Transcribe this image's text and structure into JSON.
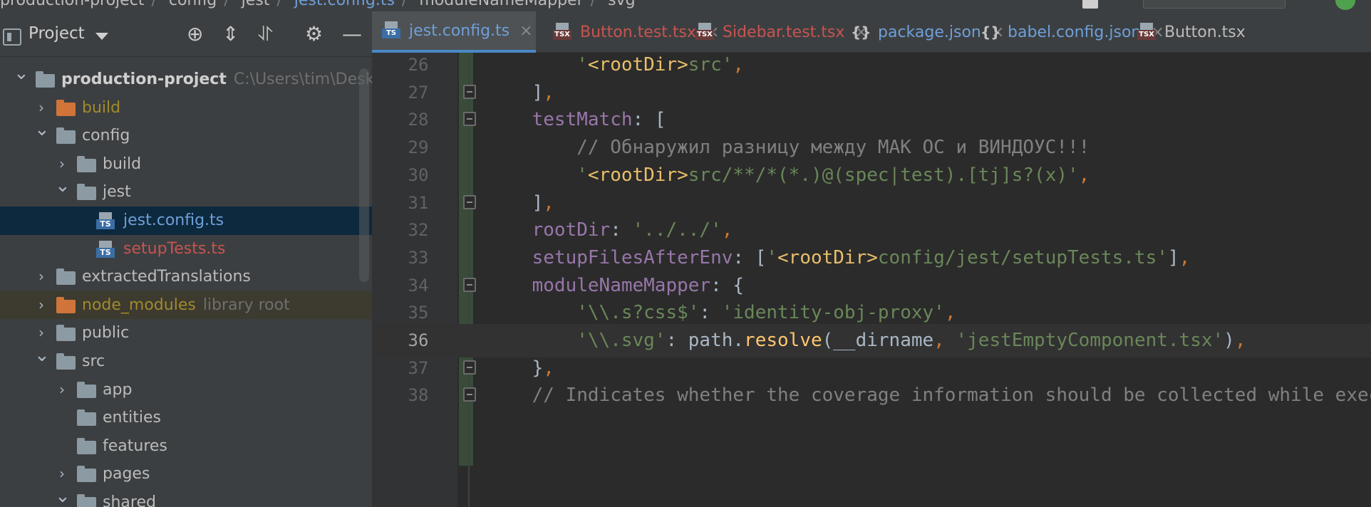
{
  "topbar": {
    "crumbs": [
      "production-project",
      "config",
      "jest",
      "jest.config.ts",
      "moduleNameMapper",
      "svg"
    ]
  },
  "project_panel": {
    "title": "Project",
    "tree": [
      {
        "name": "production-project",
        "hint": "C:\\Users\\tim\\Desktop\\",
        "depth": 0,
        "expanded": true,
        "kind": "folder",
        "style": "bold"
      },
      {
        "name": "build",
        "depth": 1,
        "expanded": false,
        "kind": "folder-orange",
        "style": "olive"
      },
      {
        "name": "config",
        "depth": 1,
        "expanded": true,
        "kind": "folder",
        "style": "normal"
      },
      {
        "name": "build",
        "depth": 2,
        "expanded": false,
        "kind": "folder",
        "style": "normal"
      },
      {
        "name": "jest",
        "depth": 2,
        "expanded": true,
        "kind": "folder",
        "style": "normal"
      },
      {
        "name": "jest.config.ts",
        "depth": 3,
        "kind": "ts",
        "style": "blue",
        "selected": true
      },
      {
        "name": "setupTests.ts",
        "depth": 3,
        "kind": "ts",
        "style": "red"
      },
      {
        "name": "extractedTranslations",
        "depth": 1,
        "expanded": false,
        "kind": "folder",
        "style": "normal"
      },
      {
        "name": "node_modules",
        "hint": "library root",
        "depth": 1,
        "expanded": false,
        "kind": "folder-orange",
        "style": "olive",
        "excluded": true
      },
      {
        "name": "public",
        "depth": 1,
        "expanded": false,
        "kind": "folder",
        "style": "normal"
      },
      {
        "name": "src",
        "depth": 1,
        "expanded": true,
        "kind": "folder",
        "style": "normal"
      },
      {
        "name": "app",
        "depth": 2,
        "expanded": false,
        "kind": "folder",
        "style": "normal"
      },
      {
        "name": "entities",
        "depth": 2,
        "kind": "folder",
        "style": "normal"
      },
      {
        "name": "features",
        "depth": 2,
        "kind": "folder",
        "style": "normal"
      },
      {
        "name": "pages",
        "depth": 2,
        "expanded": false,
        "kind": "folder",
        "style": "normal"
      },
      {
        "name": "shared",
        "depth": 2,
        "expanded": true,
        "kind": "folder",
        "style": "normal"
      }
    ]
  },
  "tabs": [
    {
      "label": "jest.config.ts",
      "icon": "ts",
      "color": "blue",
      "active": true,
      "closable": true
    },
    {
      "label": "Button.test.tsx",
      "icon": "tsx",
      "color": "red",
      "active": false,
      "closable": true
    },
    {
      "label": "Sidebar.test.tsx",
      "icon": "tsx",
      "color": "red",
      "active": false,
      "closable": true
    },
    {
      "label": "package.json",
      "icon": "json",
      "color": "blue",
      "active": false,
      "closable": true
    },
    {
      "label": "babel.config.json",
      "icon": "json",
      "color": "blue",
      "active": false,
      "closable": true
    },
    {
      "label": "Button.tsx",
      "icon": "tsx",
      "color": "normal",
      "active": false,
      "closable": false
    }
  ],
  "code_lines": [
    {
      "num": "26",
      "text": "        '<rootDir>src',"
    },
    {
      "num": "27",
      "text": "    ],"
    },
    {
      "num": "28",
      "text": "    testMatch: ["
    },
    {
      "num": "29",
      "text": "        // Обнаружил разницу между МАК ОС и ВИНДОУС!!!"
    },
    {
      "num": "30",
      "text": "        '<rootDir>src/**/*(*.)@(spec|test).[tj]s?(x)',"
    },
    {
      "num": "31",
      "text": "    ],"
    },
    {
      "num": "32",
      "text": "    rootDir: '../../',"
    },
    {
      "num": "33",
      "text": "    setupFilesAfterEnv: ['<rootDir>config/jest/setupTests.ts'],"
    },
    {
      "num": "34",
      "text": "    moduleNameMapper: {"
    },
    {
      "num": "35",
      "text": "        '\\\\.s?css$': 'identity-obj-proxy',"
    },
    {
      "num": "36",
      "text": "        '\\\\.svg': path.resolve(__dirname, 'jestEmptyComponent.tsx'),",
      "current": true
    },
    {
      "num": "37",
      "text": "    },"
    },
    {
      "num": "38",
      "text": "    // Indicates whether the coverage information should be collected while executing the test"
    }
  ],
  "colors": {
    "accent": "#4a88c7",
    "string": "#6a8759",
    "keyword": "#cc7832",
    "property": "#9876aa",
    "comment": "#808080",
    "tag": "#e8bf6a",
    "function": "#ffc66d"
  }
}
